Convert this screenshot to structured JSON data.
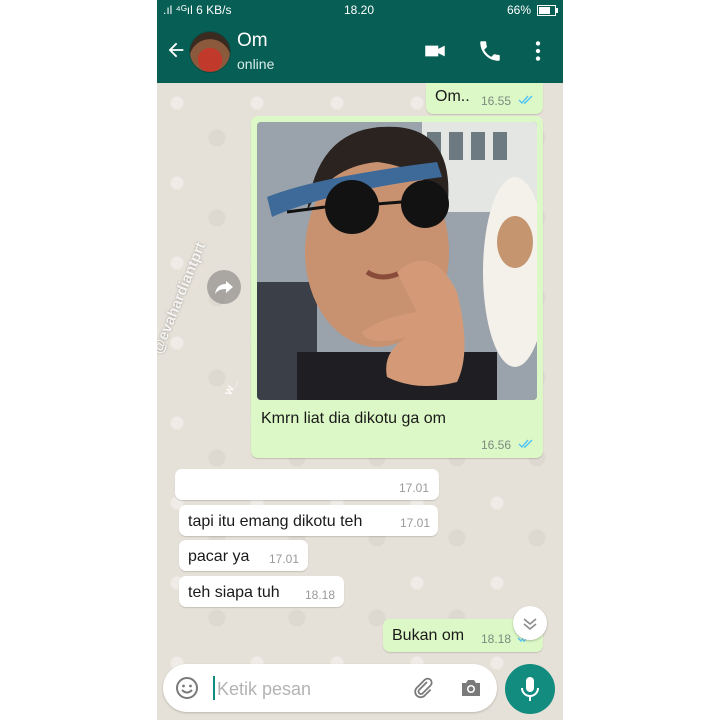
{
  "status_bar": {
    "network": ".ıl ⁴ᴳıl 6 KB/s",
    "time": "18.20",
    "battery": "66%"
  },
  "header": {
    "contact_name": "Om",
    "contact_status": "online"
  },
  "messages": [
    {
      "direction": "out",
      "text": "Om..",
      "time": "16.55",
      "read": true
    },
    {
      "direction": "out",
      "type": "image",
      "caption": "Kmrn liat dia dikotu ga om",
      "time": "16.56",
      "read": true
    },
    {
      "direction": "in",
      "text": "",
      "time": "17.01"
    },
    {
      "direction": "in",
      "text": "tapi itu emang dikotu teh",
      "time": "17.01"
    },
    {
      "direction": "in",
      "text": "pacar ya",
      "time": "17.01"
    },
    {
      "direction": "in",
      "text": "teh siapa tuh",
      "time": "18.18"
    },
    {
      "direction": "out",
      "text": "Bukan om",
      "time": "18.18",
      "read": true
    }
  ],
  "watermark": "@evahardiantprt",
  "watermark_small": "w_",
  "input": {
    "placeholder": "Ketik pesan"
  },
  "icons": [
    "back-arrow-icon",
    "video-call-icon",
    "phone-call-icon",
    "more-options-icon",
    "forward-icon",
    "emoji-icon",
    "attach-icon",
    "camera-icon",
    "mic-icon",
    "chevron-down-icon",
    "double-check-icon"
  ],
  "colors": {
    "header": "#075e54",
    "outgoing_bubble": "#dcf8c6",
    "incoming_bubble": "#ffffff",
    "read_ticks": "#4fc3f7",
    "mic_button": "#128c7e"
  }
}
